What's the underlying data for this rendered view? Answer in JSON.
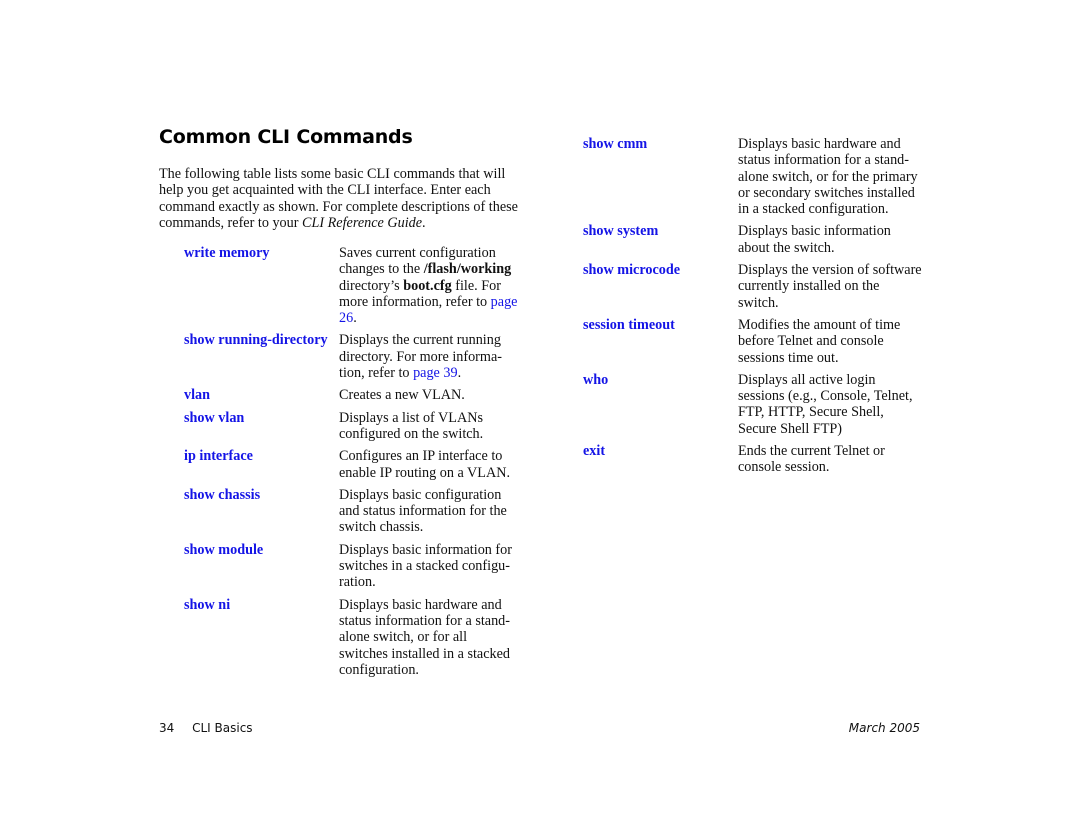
{
  "page": {
    "title": "Common CLI Commands",
    "intro": {
      "text": "The following table lists some basic CLI commands that will help you get acquainted with the CLI interface. Enter each command exactly as shown. For complete descriptions of these commands, refer to your ",
      "emphasis": "CLI Reference Guide",
      "end": "."
    },
    "left_commands": [
      {
        "cmd": "write memory",
        "parts": [
          "Saves current configuration changes to the ",
          {
            "b": "/flash/working"
          },
          " directory’s ",
          {
            "b": "boot.cfg"
          },
          " file. For more information, refer to ",
          {
            "link": "page 26"
          },
          "."
        ]
      },
      {
        "cmd": "show running-directory",
        "parts": [
          "Displays the current running directory. For more informa- tion, refer to ",
          {
            "link": "page 39"
          },
          "."
        ]
      },
      {
        "cmd": "vlan",
        "parts": [
          "Creates a new VLAN."
        ]
      },
      {
        "cmd": "show vlan",
        "parts": [
          "Displays a list of VLANs configured on the switch."
        ]
      },
      {
        "cmd": "ip interface",
        "parts": [
          "Configures an IP interface to enable IP routing on a VLAN."
        ]
      },
      {
        "cmd": "show chassis",
        "parts": [
          "Displays basic configuration and status information for the switch chassis."
        ]
      },
      {
        "cmd": "show module",
        "parts": [
          "Displays basic information for switches in a stacked configu- ration."
        ]
      },
      {
        "cmd": "show ni",
        "parts": [
          "Displays basic hardware and status information for a stand- alone switch, or for all switches installed in a stacked configuration."
        ]
      }
    ],
    "right_commands": [
      {
        "cmd": "show cmm",
        "parts": [
          "Displays basic hardware and status information for a stand- alone switch, or for the primary or secondary switches installed in a stacked configuration."
        ]
      },
      {
        "cmd": "show system",
        "parts": [
          "Displays basic information about the switch."
        ]
      },
      {
        "cmd": "show microcode",
        "parts": [
          "Displays the version of software currently installed on the switch."
        ]
      },
      {
        "cmd": "session timeout",
        "parts": [
          "Modifies the amount of time before Telnet and console sessions time out."
        ]
      },
      {
        "cmd": "who",
        "parts": [
          "Displays all active login sessions (e.g., Console, Telnet, FTP, HTTP, Secure Shell, Secure Shell FTP)"
        ]
      },
      {
        "cmd": "exit",
        "parts": [
          "Ends the current Telnet or console session."
        ]
      }
    ],
    "footer": {
      "page_number": "34",
      "section": "CLI Basics",
      "date": "March 2005"
    },
    "colors": {
      "command": "#1414e6",
      "link": "#1414e6"
    }
  }
}
